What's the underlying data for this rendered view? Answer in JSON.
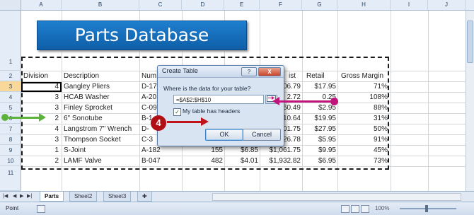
{
  "columns": [
    "A",
    "B",
    "C",
    "D",
    "E",
    "F",
    "G",
    "H",
    "I",
    "J"
  ],
  "rows": [
    "1",
    "2",
    "3",
    "4",
    "5",
    "6",
    "7",
    "8",
    "9",
    "10",
    "11"
  ],
  "title_banner": "Parts Database",
  "headers": {
    "division": "Division",
    "description": "Description",
    "number": "Num",
    "cost": "ist",
    "retail": "Retail",
    "margin": "Gross Margin"
  },
  "table_rows": [
    {
      "division": "4",
      "description": "Gangley Pliers",
      "number": "D-17",
      "qty": "",
      "unit": "",
      "cost": "06.79",
      "retail": "$17.95",
      "margin": "71%"
    },
    {
      "division": "3",
      "description": "HCAB Washer",
      "number": "A-20",
      "qty": "",
      "unit": "",
      "cost": "2.72",
      "retail": "0.25",
      "margin": "108%"
    },
    {
      "division": "3",
      "description": "Finley Sprocket",
      "number": "C-09",
      "qty": "",
      "unit": "",
      "cost": "60.49",
      "retail": "$2.95",
      "margin": "88%"
    },
    {
      "division": "2",
      "description": "6\" Sonotube",
      "number": "B-1",
      "qty": "",
      "unit": "",
      "cost": "10.64",
      "retail": "$19.95",
      "margin": "31%"
    },
    {
      "division": "4",
      "description": "Langstrom 7\" Wrench",
      "number": "D-",
      "qty": "",
      "unit": "",
      "cost": "01.75",
      "retail": "$27.95",
      "margin": "50%"
    },
    {
      "division": "3",
      "description": "Thompson Socket",
      "number": "C-3",
      "qty": "",
      "unit": "",
      "cost": "26.78",
      "retail": "$5.95",
      "margin": "91%"
    },
    {
      "division": "1",
      "description": "S-Joint",
      "number": "A-182",
      "qty": "155",
      "unit": "$6.85",
      "cost": "$1,061.75",
      "retail": "$9.95",
      "margin": "45%"
    },
    {
      "division": "2",
      "description": "LAMF Valve",
      "number": "B-047",
      "qty": "482",
      "unit": "$4.01",
      "cost": "$1,932.82",
      "retail": "$6.95",
      "margin": "73%"
    }
  ],
  "dialog": {
    "title": "Create Table",
    "help": "?",
    "close": "X",
    "prompt": "Where is the data for your table?",
    "range_value": "=$A$2:$H$10",
    "range_button_icon": "collapse-dialog-icon",
    "checkbox_checked": true,
    "checkbox_label": "My table has headers",
    "ok_label": "OK",
    "cancel_label": "Cancel"
  },
  "callout": {
    "step": "4"
  },
  "sheet_tabs": [
    "Parts",
    "Sheet2",
    "Sheet3"
  ],
  "active_tab": "Parts",
  "status": {
    "mode": "Point",
    "zoom": "100%"
  }
}
